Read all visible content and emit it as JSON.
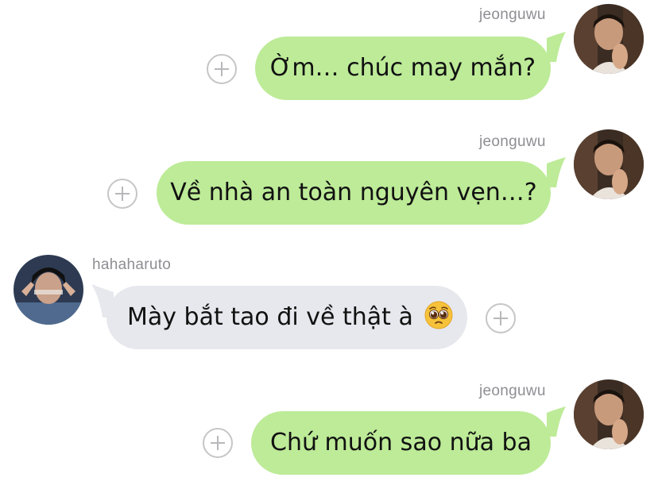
{
  "messages": [
    {
      "sender": "jeonguwu",
      "text": "Ờm… chúc may mắn?",
      "direction": "outgoing"
    },
    {
      "sender": "jeonguwu",
      "text": "Về nhà an toàn nguyên vẹn…?",
      "direction": "outgoing"
    },
    {
      "sender": "hahaharuto",
      "text": "Mày bắt tao đi về thật à",
      "emoji": "pleading-face-emoji",
      "direction": "incoming"
    },
    {
      "sender": "jeonguwu",
      "text": "Chứ muốn sao nữa ba",
      "direction": "outgoing"
    }
  ],
  "colors": {
    "outgoing_bubble": "#bdeb98",
    "incoming_bubble": "#e6e8ed",
    "username_text": "#8e8e93",
    "background": "#ffffff"
  },
  "icons": [
    "add-reaction-icon",
    "avatar-photo",
    "pleading-face-emoji"
  ]
}
